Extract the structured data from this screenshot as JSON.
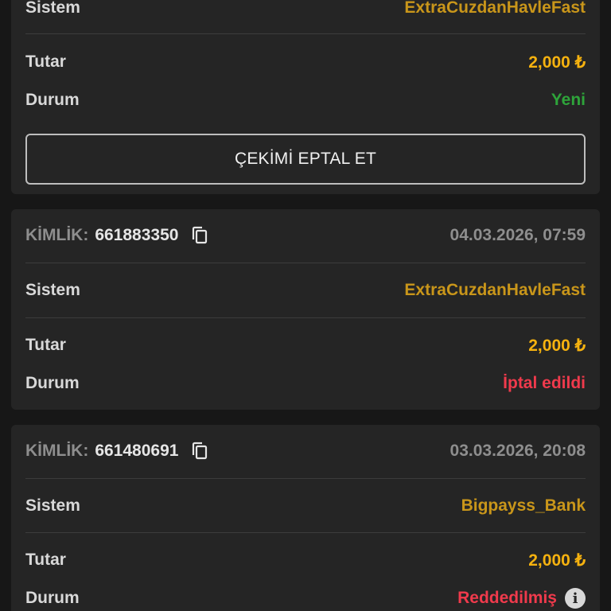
{
  "card1": {
    "system_label": "Sistem",
    "system_value": "ExtraCuzdanHavleFast",
    "amount_label": "Tutar",
    "amount_value": "2,000 ₺",
    "status_label": "Durum",
    "status_value": "Yeni",
    "cancel_button": "ÇEKİMİ EPTAL ET"
  },
  "card2": {
    "id_label": "KİMLİK:",
    "id_value": "661883350",
    "date": "04.03.2026, 07:59",
    "system_label": "Sistem",
    "system_value": "ExtraCuzdanHavleFast",
    "amount_label": "Tutar",
    "amount_value": "2,000 ₺",
    "status_label": "Durum",
    "status_value": "İptal edildi"
  },
  "card3": {
    "id_label": "KİMLİK:",
    "id_value": "661480691",
    "date": "03.03.2026, 20:08",
    "system_label": "Sistem",
    "system_value": "Bigpayss_Bank",
    "amount_label": "Tutar",
    "amount_value": "2,000 ₺",
    "status_label": "Durum",
    "status_value": "Reddedilmiş"
  },
  "colors": {
    "background": "#171717",
    "card": "#252525",
    "system": "#c9961a",
    "amount": "#f6b20f",
    "status_new": "#2ea43a",
    "status_cancelled": "#f03a4c",
    "status_rejected": "#f03a4c"
  },
  "icons": {
    "copy": "copy-icon",
    "info": "info-icon"
  }
}
